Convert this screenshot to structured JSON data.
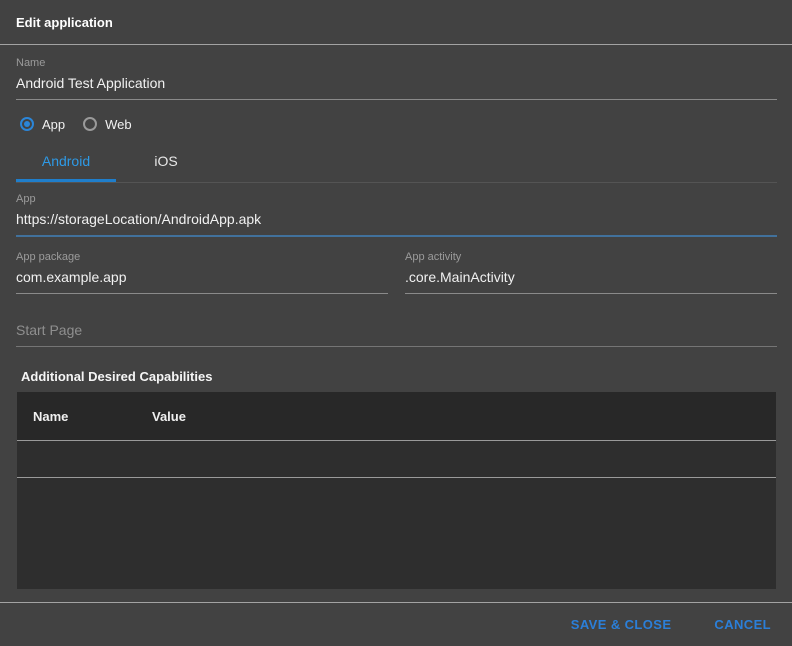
{
  "dialog": {
    "title": "Edit application",
    "accent_color": "#2b86d9",
    "tab_active_color": "#2e9ae6",
    "button_color": "#2b7fd9",
    "focused_underline_color": "#41719c",
    "background_color": "#424242",
    "table_background_color": "#2e2e2e"
  },
  "fields": {
    "name": {
      "label": "Name",
      "value": "Android Test Application"
    },
    "app": {
      "label": "App",
      "value": "https://storageLocation/AndroidApp.apk"
    },
    "app_package": {
      "label": "App package",
      "value": "com.example.app"
    },
    "app_activity": {
      "label": "App activity",
      "value": ".core.MainActivity"
    },
    "start_page": {
      "placeholder": "Start Page",
      "value": ""
    }
  },
  "radios": [
    {
      "label": "App",
      "selected": true
    },
    {
      "label": "Web",
      "selected": false
    }
  ],
  "tabs": [
    {
      "label": "Android",
      "active": true
    },
    {
      "label": "iOS",
      "active": false
    }
  ],
  "capabilities": {
    "heading": "Additional Desired Capabilities",
    "columns": [
      "Name",
      "Value"
    ],
    "rows": []
  },
  "footer": {
    "save_label": "SAVE & CLOSE",
    "cancel_label": "CANCEL"
  }
}
